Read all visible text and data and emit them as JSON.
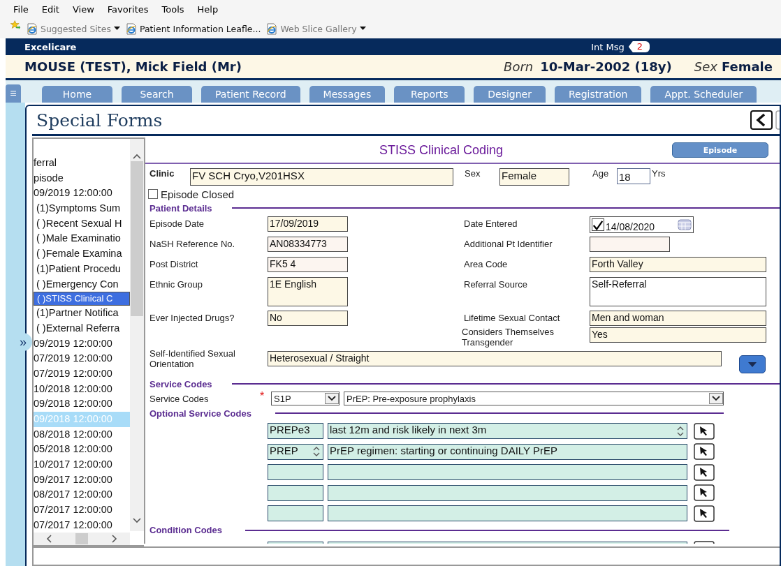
{
  "menu_bar": [
    "File",
    "Edit",
    "View",
    "Favorites",
    "Tools",
    "Help"
  ],
  "favorites_bar": [
    {
      "label": "Suggested Sites",
      "greyed": true,
      "dropdown": true
    },
    {
      "label": "Patient Information Leafle...",
      "greyed": false,
      "dropdown": false
    },
    {
      "label": "Web Slice Gallery",
      "greyed": true,
      "dropdown": true
    }
  ],
  "app_bar": {
    "title": "Excelicare",
    "messages_label": "Int Msg",
    "messages_count": "2"
  },
  "patient_banner": {
    "name": "MOUSE (TEST), Mick Field (Mr)",
    "born_label": "Born",
    "born_value": "10-Mar-2002 (18y)",
    "sex_label": "Sex",
    "sex_value": "Female"
  },
  "nav": {
    "menu_glyph": "≡",
    "tabs": [
      "Home",
      "Search",
      "Patient Record",
      "Messages",
      "Reports",
      "Designer",
      "Registration",
      "Appt. Scheduler"
    ]
  },
  "side_toggle": "»",
  "page_title": "Special Forms",
  "tree": [
    {
      "label": "ferral",
      "selected": false,
      "highlighted": false
    },
    {
      "label": "pisode",
      "selected": false,
      "highlighted": false
    },
    {
      "label": "09/2019 12:00:00",
      "selected": false,
      "highlighted": false,
      "children": [
        {
          "label": "(1)Symptoms Sum",
          "selected": false,
          "highlighted": false
        },
        {
          "label": "( )Recent Sexual H",
          "selected": false,
          "highlighted": false
        },
        {
          "label": "( )Male Examinatio",
          "selected": false,
          "highlighted": false
        },
        {
          "label": "( )Female Examina",
          "selected": false,
          "highlighted": false
        },
        {
          "label": "(1)Patient Procedu",
          "selected": false,
          "highlighted": false
        },
        {
          "label": "( )Emergency Con",
          "selected": false,
          "highlighted": false
        },
        {
          "label": "( )STISS Clinical C",
          "selected": true,
          "highlighted": false
        },
        {
          "label": "(1)Partner Notifica",
          "selected": false,
          "highlighted": false
        },
        {
          "label": "( )External Referra",
          "selected": false,
          "highlighted": false
        }
      ]
    },
    {
      "label": "09/2019 12:00:00",
      "selected": false,
      "highlighted": false
    },
    {
      "label": "07/2019 12:00:00",
      "selected": false,
      "highlighted": false
    },
    {
      "label": "07/2019 12:00:00",
      "selected": false,
      "highlighted": false
    },
    {
      "label": "10/2018 12:00:00",
      "selected": false,
      "highlighted": false
    },
    {
      "label": "09/2018 12:00:00",
      "selected": false,
      "highlighted": false
    },
    {
      "label": "09/2018 12:00:00",
      "selected": false,
      "highlighted": true
    },
    {
      "label": "08/2018 12:00:00",
      "selected": false,
      "highlighted": false
    },
    {
      "label": "05/2018 12:00:00",
      "selected": false,
      "highlighted": false
    },
    {
      "label": "10/2017 12:00:00",
      "selected": false,
      "highlighted": false
    },
    {
      "label": "09/2017 12:00:00",
      "selected": false,
      "highlighted": false
    },
    {
      "label": "08/2017 12:00:00",
      "selected": false,
      "highlighted": false
    },
    {
      "label": "07/2017 12:00:00",
      "selected": false,
      "highlighted": false
    },
    {
      "label": "07/2017 12:00:00",
      "selected": false,
      "highlighted": false
    }
  ],
  "form": {
    "title": "STISS Clinical Coding",
    "episode_button": "Episode",
    "clinic": {
      "label": "Clinic",
      "value": "FV SCH Cryo,V201HSX"
    },
    "sex": {
      "label": "Sex",
      "value": "Female"
    },
    "age": {
      "label": "Age",
      "value": "18",
      "unit": "Yrs"
    },
    "episode_closed": {
      "label": "Episode Closed",
      "checked": false
    },
    "patient_details": {
      "heading": "Patient Details",
      "rows": [
        {
          "left": {
            "label": "Episode Date",
            "value": "17/09/2019",
            "color": "#fdf8e6",
            "kind": "text"
          },
          "right": {
            "label": "Date Entered",
            "value": "14/08/2020",
            "color": "#ffffff",
            "kind": "date",
            "checked": true
          }
        },
        {
          "left": {
            "label": "NaSH Reference No.",
            "value": "AN08334773",
            "color": "#fcf5f0",
            "kind": "text"
          },
          "right": {
            "label": "Additional Pt Identifier",
            "color": "#fcf5f0",
            "kind": "short"
          }
        },
        {
          "left": {
            "label": "Post District",
            "value": "FK5 4",
            "color": "#fcf5f0",
            "kind": "text"
          },
          "right": {
            "label": "Area Code",
            "value": "Forth Valley",
            "color": "#fdf8e6",
            "kind": "text"
          }
        },
        {
          "left": {
            "label": "Ethnic Group",
            "value": "1E English",
            "color": "#fdf8e6",
            "kind": "textarea"
          },
          "right": {
            "label": "Referral Source",
            "value": "Self-Referral",
            "color": "#ffffff",
            "kind": "textarea"
          }
        },
        {
          "left": {
            "label": "Ever Injected Drugs?",
            "value": "No",
            "color": "#fdf8e6",
            "kind": "text"
          },
          "right": {
            "label": "Lifetime Sexual Contact",
            "value": "Men and woman",
            "color": "#fdf8e6",
            "kind": "text"
          }
        },
        {
          "right": {
            "label": "Considers Themselves Transgender",
            "value": "Yes",
            "color": "#fdf8e6",
            "kind": "text"
          }
        }
      ]
    },
    "orientation": {
      "label": "Self-Identified Sexual Orientation",
      "value": "Heterosexual / Straight"
    },
    "service_codes": {
      "heading": "Service Codes",
      "label": "Service Codes",
      "required_mark": "*",
      "code": "S1P",
      "description": "PrEP: Pre-exposure prophylaxis"
    },
    "optional_service_codes": {
      "heading": "Optional Service Codes",
      "rows": [
        {
          "code": "PREPe3",
          "description": "last 12m and risk likely in next 3m",
          "code_spinner": false,
          "description_spinner": true
        },
        {
          "code": "PREP",
          "description": "PrEP regimen: starting or continuing DAILY PrEP",
          "code_spinner": true,
          "description_spinner": false
        },
        {
          "code_spinner": false,
          "description_spinner": false
        },
        {
          "code_spinner": false,
          "description_spinner": false
        },
        {
          "code_spinner": false,
          "description_spinner": false
        }
      ]
    },
    "condition_codes": {
      "heading": "Condition Codes"
    }
  }
}
